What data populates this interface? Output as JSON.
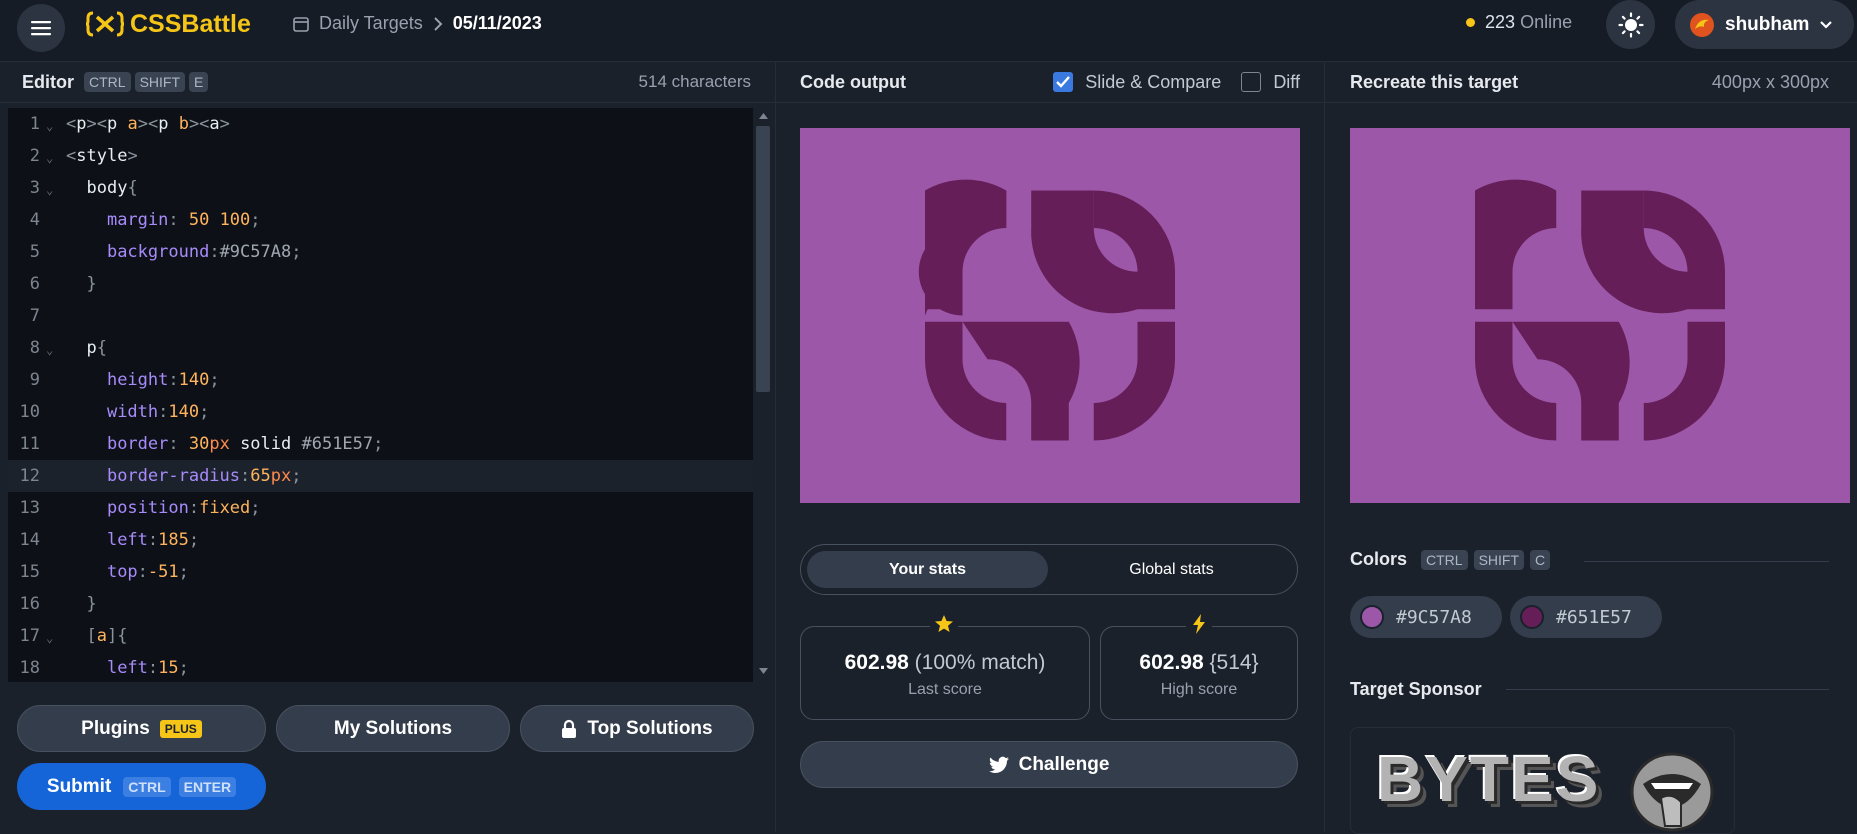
{
  "header": {
    "logo_text": "CSSBattle",
    "breadcrumb_section": "Daily Targets",
    "breadcrumb_date": "05/11/2023",
    "online_count": "223",
    "online_label": "Online",
    "username": "shubham"
  },
  "editor": {
    "title": "Editor",
    "shortcut": [
      "CTRL",
      "SHIFT",
      "E"
    ],
    "char_count": "514 characters",
    "line_numbers": [
      "1",
      "2",
      "3",
      "4",
      "5",
      "6",
      "7",
      "8",
      "9",
      "10",
      "11",
      "12",
      "13",
      "14",
      "15",
      "16",
      "17",
      "18"
    ]
  },
  "output": {
    "title": "Code output",
    "slide_compare_label": "Slide & Compare",
    "slide_compare_checked": true,
    "diff_label": "Diff",
    "diff_checked": false
  },
  "target": {
    "title": "Recreate this target",
    "dimensions": "400px x 300px"
  },
  "stats": {
    "tab_your": "Your stats",
    "tab_global": "Global stats",
    "last_score_value": "602.98",
    "last_score_match": "(100% match)",
    "last_score_label": "Last score",
    "high_score_value": "602.98",
    "high_score_chars": "{514}",
    "high_score_label": "High score",
    "challenge_label": "Challenge"
  },
  "colors": {
    "title": "Colors",
    "shortcut": [
      "CTRL",
      "SHIFT",
      "C"
    ],
    "swatches": [
      {
        "hex": "#9C57A8"
      },
      {
        "hex": "#651E57"
      }
    ]
  },
  "sponsor": {
    "title": "Target Sponsor",
    "logo_text": "BYTES"
  },
  "actions": {
    "plugins_label": "Plugins",
    "plugins_badge": "PLUS",
    "my_solutions_label": "My Solutions",
    "top_solutions_label": "Top Solutions",
    "submit_label": "Submit",
    "submit_shortcut": [
      "CTRL",
      "ENTER"
    ]
  },
  "theme": {
    "accent": "#f5c518",
    "canvas_bg": "#9C57A8",
    "shape_color": "#651E57",
    "submit_blue": "#1565d8"
  }
}
